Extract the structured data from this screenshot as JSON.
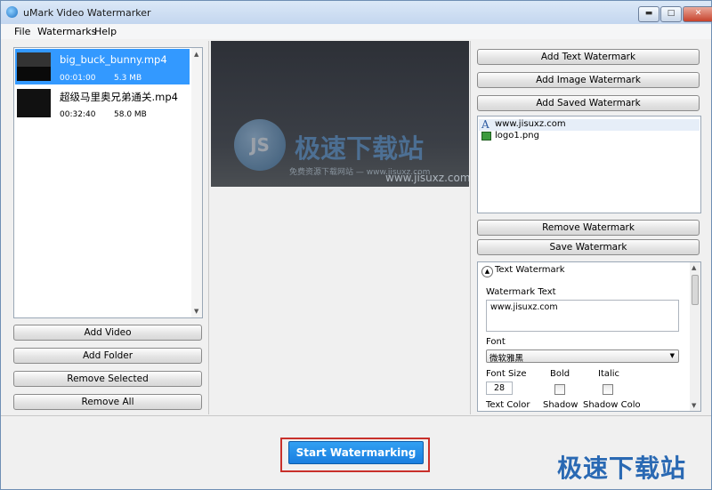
{
  "window": {
    "title": "uMark Video Watermarker",
    "minimize": "▬",
    "maximize": "□",
    "close": "✕"
  },
  "menu": [
    "File",
    "Watermarks",
    "Help"
  ],
  "videos": [
    {
      "name": "big_buck_bunny.mp4",
      "duration": "00:01:00",
      "size": "5.3 MB",
      "selected": true
    },
    {
      "name": "超级马里奥兄弟通关.mp4",
      "duration": "00:32:40",
      "size": "58.0 MB",
      "selected": false
    }
  ],
  "left_buttons": {
    "add_video": "Add Video",
    "add_folder": "Add Folder",
    "remove_selected": "Remove Selected",
    "remove_all": "Remove All"
  },
  "preview": {
    "logo_text": "JS",
    "big_text": "极速下载站",
    "sub_text": "免费资源下载网站 — www.jisuxz.com",
    "url_text": "www.jisuxz.com"
  },
  "right_buttons": {
    "add_text": "Add Text Watermark",
    "add_image": "Add Image Watermark",
    "add_saved": "Add Saved Watermark",
    "remove": "Remove Watermark",
    "save": "Save Watermark"
  },
  "watermarks": [
    {
      "type": "text",
      "label": "www.jisuxz.com",
      "icon": "text-a-icon"
    },
    {
      "type": "image",
      "label": "logo1.png",
      "icon": "image-icon"
    }
  ],
  "props": {
    "section_title": "Text Watermark",
    "watermark_text_label": "Watermark Text",
    "watermark_text_value": "www.jisuxz.com",
    "font_label": "Font",
    "font_value": "微软雅黑",
    "font_size_label": "Font Size",
    "font_size_value": "28",
    "bold_label": "Bold",
    "italic_label": "Italic",
    "text_color_label": "Text Color",
    "shadow_label": "Shadow",
    "shadow_color_label": "Shadow Colo"
  },
  "start_button": "Start Watermarking",
  "brand": "极速下载站"
}
